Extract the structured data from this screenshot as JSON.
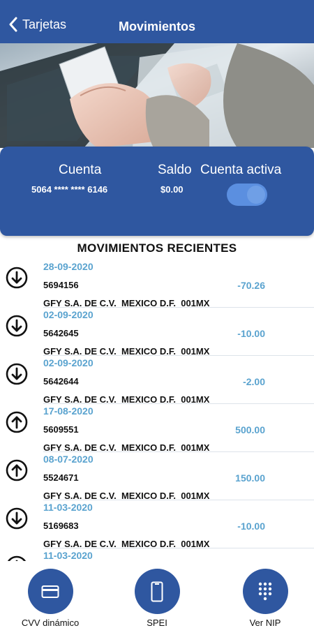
{
  "nav": {
    "back_label": "Tarjetas",
    "title": "Movimientos"
  },
  "account": {
    "cuenta_label": "Cuenta",
    "cuenta_number": "5064 **** **** 6146",
    "saldo_label": "Saldo",
    "saldo_value": "$0.00",
    "activa_label": "Cuenta activa",
    "activa_on": true
  },
  "section_title": "MOVIMIENTOS RECIENTES",
  "transactions": [
    {
      "direction": "down",
      "date": "28-09-2020",
      "ref": "5694156",
      "amount": "-70.26",
      "desc": "GFY S.A. DE C.V.  MEXICO D.F.  001MX"
    },
    {
      "direction": "down",
      "date": "02-09-2020",
      "ref": "5642645",
      "amount": "-10.00",
      "desc": "GFY S.A. DE C.V.  MEXICO D.F.  001MX"
    },
    {
      "direction": "down",
      "date": "02-09-2020",
      "ref": "5642644",
      "amount": "-2.00",
      "desc": "GFY S.A. DE C.V.  MEXICO D.F.  001MX"
    },
    {
      "direction": "up",
      "date": "17-08-2020",
      "ref": "5609551",
      "amount": "500.00",
      "desc": "GFY S.A. DE C.V.  MEXICO D.F.  001MX"
    },
    {
      "direction": "up",
      "date": "08-07-2020",
      "ref": "5524671",
      "amount": "150.00",
      "desc": "GFY S.A. DE C.V.  MEXICO D.F.  001MX"
    },
    {
      "direction": "down",
      "date": "11-03-2020",
      "ref": "5169683",
      "amount": "-10.00",
      "desc": "GFY S.A. DE C.V.  MEXICO D.F.  001MX"
    },
    {
      "direction": "down",
      "date": "11-03-2020",
      "ref": "",
      "amount": "",
      "desc": ""
    }
  ],
  "actions": {
    "cvv_label": "CVV dinámico",
    "spei_label": "SPEI",
    "nip_label": "Ver NIP"
  },
  "colors": {
    "primary": "#2f57a0",
    "accent": "#5aa3cf",
    "toggle": "#5b8fe0"
  }
}
